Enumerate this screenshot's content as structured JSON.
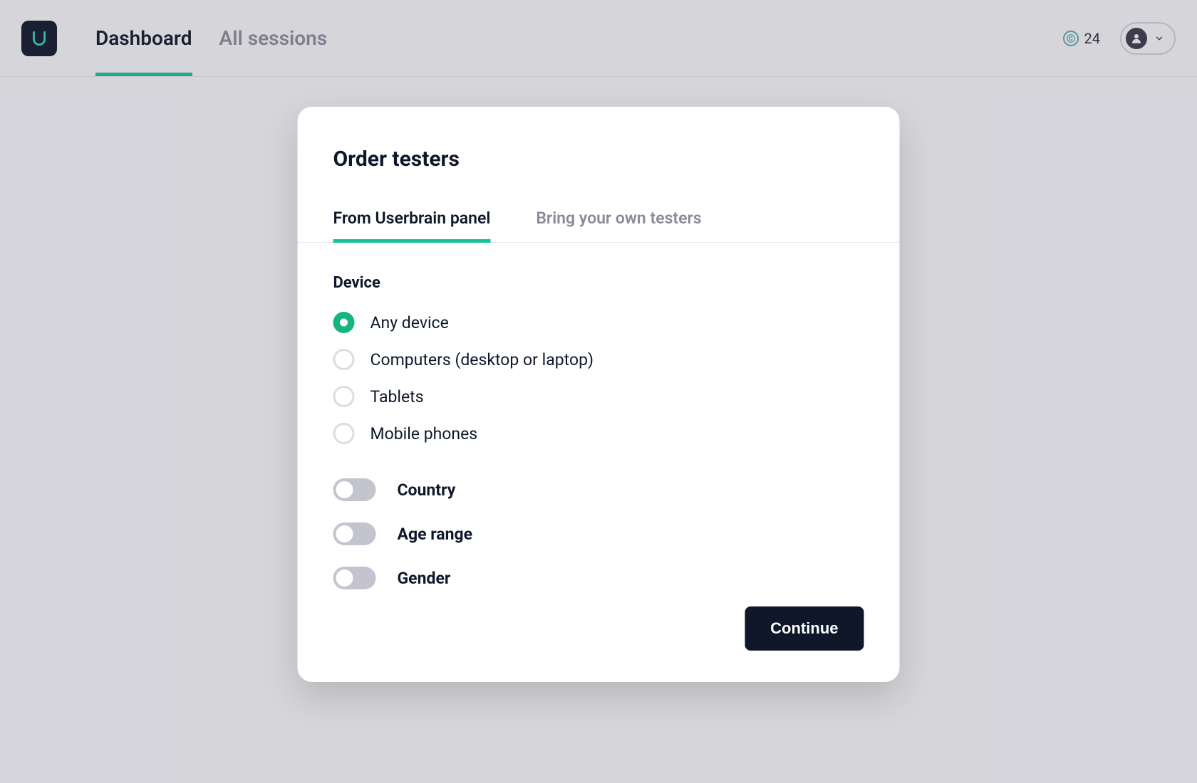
{
  "header": {
    "nav": {
      "dashboard": "Dashboard",
      "all_sessions": "All sessions"
    },
    "credits_count": "24"
  },
  "modal": {
    "title": "Order testers",
    "tabs": {
      "panel": "From Userbrain panel",
      "byo": "Bring your own testers"
    },
    "device": {
      "label": "Device",
      "options": {
        "any": "Any device",
        "computers": "Computers (desktop or laptop)",
        "tablets": "Tablets",
        "mobile": "Mobile phones"
      },
      "selected": "any"
    },
    "toggles": {
      "country": "Country",
      "age": "Age range",
      "gender": "Gender"
    },
    "continue_label": "Continue"
  }
}
